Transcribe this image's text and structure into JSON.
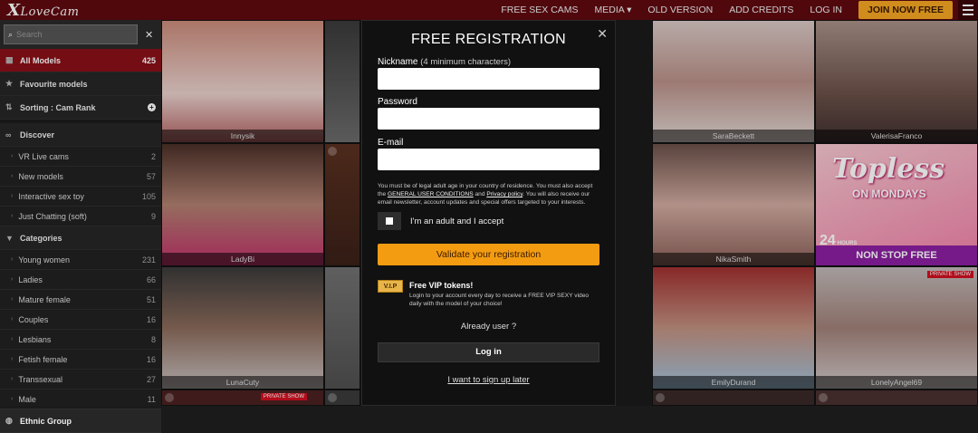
{
  "brand": {
    "logo_first": "X",
    "logo_rest": "LoveCam"
  },
  "nav": {
    "items": [
      "FREE SEX CAMS",
      "MEDIA",
      "OLD VERSION",
      "ADD CREDITS",
      "LOG IN"
    ],
    "media_chevron": "▾",
    "join": "JOIN NOW FREE"
  },
  "search": {
    "placeholder": "Search"
  },
  "sidebar": {
    "all_models": {
      "label": "All Models",
      "count": "425"
    },
    "favourite": "Favourite models",
    "sorting": "Sorting : Cam Rank",
    "discover": {
      "label": "Discover",
      "items": [
        {
          "label": "VR Live cams",
          "count": "2"
        },
        {
          "label": "New models",
          "count": "57"
        },
        {
          "label": "Interactive sex toy",
          "count": "105"
        },
        {
          "label": "Just Chatting (soft)",
          "count": "9"
        }
      ]
    },
    "categories": {
      "label": "Categories",
      "items": [
        {
          "label": "Young women",
          "count": "231"
        },
        {
          "label": "Ladies",
          "count": "66"
        },
        {
          "label": "Mature female",
          "count": "51"
        },
        {
          "label": "Couples",
          "count": "16"
        },
        {
          "label": "Lesbians",
          "count": "8"
        },
        {
          "label": "Fetish female",
          "count": "16"
        },
        {
          "label": "Transsexual",
          "count": "27"
        },
        {
          "label": "Male",
          "count": "11"
        }
      ]
    },
    "ethnic": "Ethnic Group"
  },
  "grid": {
    "models": [
      "Innysik",
      "SaraBeckett",
      "ValerisaFranco",
      "LadyBi",
      "NikaSmith",
      "LunaCuty",
      "EmilyDurand",
      "LonelyAngel69"
    ],
    "promo": {
      "title": "Topless",
      "subtitle": "ON MONDAYS",
      "banner": "NON STOP FREE",
      "number": "24",
      "number_unit": "HOURS"
    },
    "private_show": "PRIVATE SHOW"
  },
  "modal": {
    "title": "FREE REGISTRATION",
    "nickname_label": "Nickname",
    "nickname_hint": "(4 minimum characters)",
    "password_label": "Password",
    "email_label": "E-mail",
    "legal_1": "You must be of legal adult age in your country of residence. You must also accept the ",
    "legal_link1": "GENERAL USER CONDITIONS",
    "legal_2": " and ",
    "legal_link2": "Privacy policy",
    "legal_3": ". You will also receive our email newsletter, account updates and special offers targeted to your interests.",
    "accept": "I'm an adult and I accept",
    "validate": "Validate your registration",
    "vip_badge": "V.I.P",
    "vip_title": "Free VIP tokens!",
    "vip_text": "Login to your account every day to receive a FREE VIP SEXY video daily with the model of your choice!",
    "already": "Already user ?",
    "login": "Log in",
    "later": "I want to sign up later"
  },
  "colors": {
    "topbar": "#5e0a10",
    "accent": "#f39c12",
    "active": "#8a1018"
  }
}
